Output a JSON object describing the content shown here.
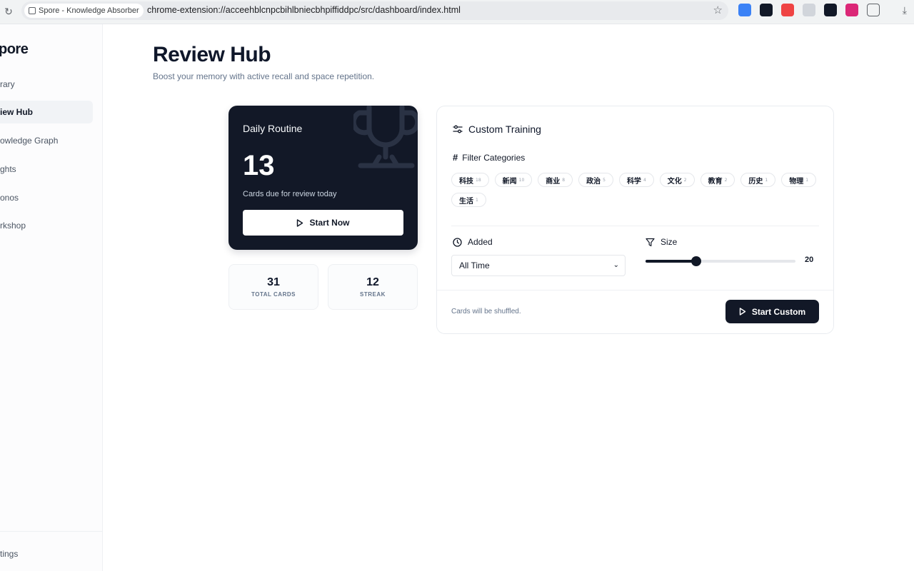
{
  "browser": {
    "tab_title": "Spore - Knowledge Absorber",
    "url": "chrome-extension://acceehblcnpcbihlbniecbhpiffiddpc/src/dashboard/index.html"
  },
  "sidebar": {
    "logo": "pore",
    "items": [
      {
        "label": "rary"
      },
      {
        "label": "iew Hub"
      },
      {
        "label": "owledge Graph"
      },
      {
        "label": "ghts"
      },
      {
        "label": "onos"
      },
      {
        "label": "rkshop"
      }
    ],
    "footer_item": "tings"
  },
  "header": {
    "title": "Review Hub",
    "subtitle": "Boost your memory with active recall and space repetition."
  },
  "daily": {
    "title": "Daily Routine",
    "count": "13",
    "caption": "Cards due for review today",
    "button": "Start Now"
  },
  "stats": [
    {
      "value": "31",
      "label": "TOTAL CARDS"
    },
    {
      "value": "12",
      "label": "STREAK"
    }
  ],
  "custom": {
    "title": "Custom Training",
    "filter_label": "Filter Categories",
    "categories": [
      {
        "name": "科技",
        "count": "18"
      },
      {
        "name": "新闻",
        "count": "10"
      },
      {
        "name": "商业",
        "count": "8"
      },
      {
        "name": "政治",
        "count": "5"
      },
      {
        "name": "科学",
        "count": "4"
      },
      {
        "name": "文化",
        "count": "2"
      },
      {
        "name": "教育",
        "count": "2"
      },
      {
        "name": "历史",
        "count": "1"
      },
      {
        "name": "物理",
        "count": "1"
      },
      {
        "name": "生活",
        "count": "1"
      }
    ],
    "added_label": "Added",
    "added_value": "All Time",
    "size_label": "Size",
    "size_value": "20",
    "size_fraction": 0.34,
    "note": "Cards will be shuffled.",
    "button": "Start Custom"
  }
}
